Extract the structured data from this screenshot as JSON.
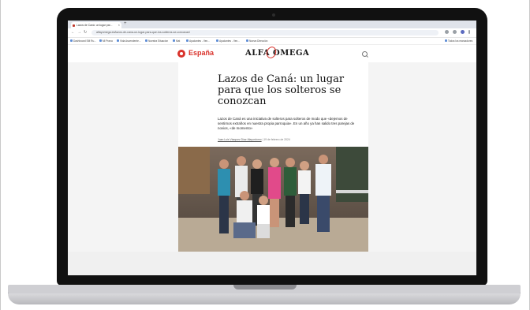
{
  "browser": {
    "tab_title": "Lazos de Caná: un lugar par...",
    "url": "alfayomega.es/lazos-de-cana-un-lugar-para-que-los-solteros-se-conozcan/",
    "bookmarks": [
      "Dashboard SM Ru...",
      "Mi Prana",
      "Vida Ascendente...",
      "Nuestra Situacion",
      "Mat",
      "Ayudantes - Ven...",
      "Ayudantes - Ven...",
      "Nueva Dirección"
    ],
    "all_bookmarks": "Todos los marcadores"
  },
  "site": {
    "section": "España",
    "brand": "ALFA OMEGA"
  },
  "article": {
    "headline": "Lazos de Caná: un lugar para que los solteros se conozcan",
    "subtitle": "Lazos de Caná es una iniciativa de solteros para solteros de modo que «dejemos de sentirnos extraños en nuestra propia parroquia». En un año ya han salido tres parejas de novios, «de momento»",
    "author": "Juan Luis Vázquez Díaz-Mayordomo",
    "date": "19 de febrero de 2024"
  },
  "colors": {
    "accent": "#d9322b",
    "device": "#111111"
  }
}
